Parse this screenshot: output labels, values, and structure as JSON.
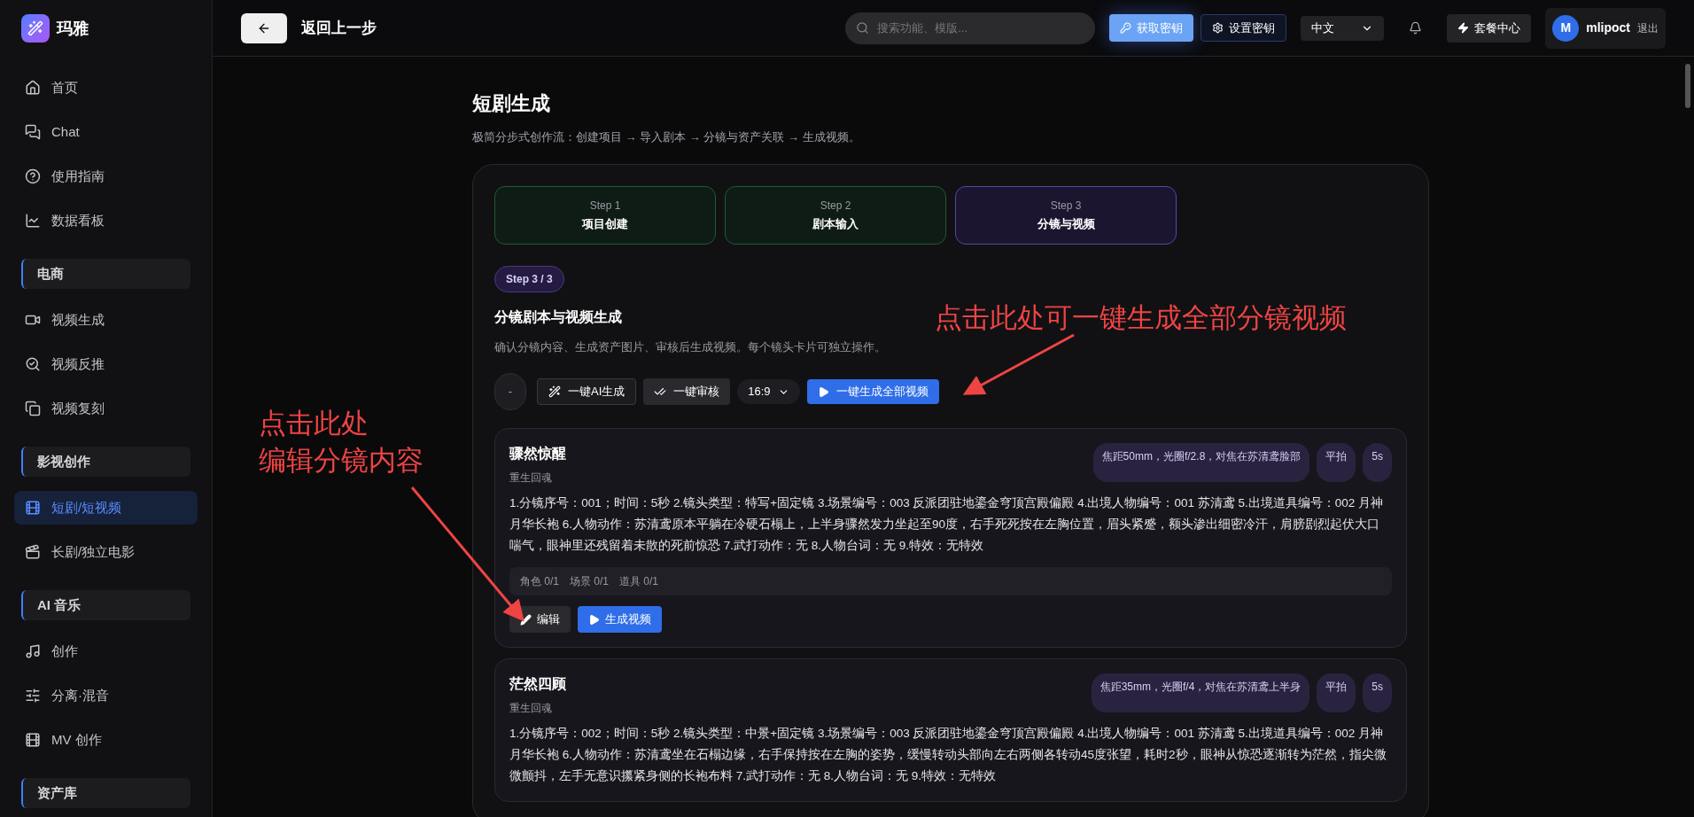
{
  "brand": {
    "name": "玛雅"
  },
  "sidebar": {
    "items": [
      {
        "kind": "item",
        "label": "首页",
        "selected": false
      },
      {
        "kind": "item",
        "label": "Chat",
        "selected": false
      },
      {
        "kind": "item",
        "label": "使用指南",
        "selected": false
      },
      {
        "kind": "item",
        "label": "数据看板",
        "selected": false
      },
      {
        "kind": "group",
        "label": "电商"
      },
      {
        "kind": "item",
        "label": "视频生成",
        "selected": false
      },
      {
        "kind": "item",
        "label": "视频反推",
        "selected": false
      },
      {
        "kind": "item",
        "label": "视频复刻",
        "selected": false
      },
      {
        "kind": "group",
        "label": "影视创作"
      },
      {
        "kind": "item",
        "label": "短剧/短视频",
        "selected": true
      },
      {
        "kind": "item",
        "label": "长剧/独立电影",
        "selected": false
      },
      {
        "kind": "group",
        "label": "AI 音乐"
      },
      {
        "kind": "item",
        "label": "创作",
        "selected": false
      },
      {
        "kind": "item",
        "label": "分离·混音",
        "selected": false
      },
      {
        "kind": "item",
        "label": "MV 创作",
        "selected": false
      },
      {
        "kind": "group",
        "label": "资产库"
      }
    ]
  },
  "topbar": {
    "back_label": "返回上一步",
    "search": {
      "placeholder": "搜索功能、模版..."
    },
    "get_key": "获取密钥",
    "set_key": "设置密钥",
    "language": "中文",
    "plans": "套餐中心",
    "user": {
      "initial": "M",
      "name": "mlipoct",
      "logout": "退出"
    }
  },
  "page": {
    "title": "短剧生成",
    "subtitle": "极简分步式创作流：创建项目 → 导入剧本 → 分镜与资产关联 → 生成视频。"
  },
  "steps": [
    {
      "step": "Step 1",
      "label": "项目创建",
      "selected": false
    },
    {
      "step": "Step 2",
      "label": "剧本输入",
      "selected": false
    },
    {
      "step": "Step 3",
      "label": "分镜与视频",
      "selected": true
    }
  ],
  "section": {
    "badge": "Step 3 / 3",
    "title": "分镜剧本与视频生成",
    "description": "确认分镜内容、生成资产图片、审核后生成视频。每个镜头卡片可独立操作。"
  },
  "toolbar": {
    "collapse": "-",
    "ai_generate": "一键AI生成",
    "review": "一键审核",
    "ratio": "16:9",
    "generate_all": "一键生成全部视频"
  },
  "shots": [
    {
      "title": "骤然惊醒",
      "subtitle": "重生回魂",
      "tags": [
        "焦距50mm，光圈f/2.8，对焦在苏清鸢脸部",
        "平拍",
        "5s"
      ],
      "description": "1.分镜序号：001；时间：5秒 2.镜头类型：特写+固定镜 3.场景编号：003 反派团驻地鎏金穹顶宫殿偏殿 4.出境人物编号：001 苏清鸢 5.出境道具编号：002 月神月华长袍 6.人物动作：苏清鸢原本平躺在冷硬石榻上，上半身骤然发力坐起至90度，右手死死按在左胸位置，眉头紧蹙，额头渗出细密冷汗，肩膀剧烈起伏大口喘气，眼神里还残留着未散的死前惊恐 7.武打动作：无 8.人物台词：无 9.特效：无特效",
      "assets": [
        "角色 0/1",
        "场景 0/1",
        "道具 0/1"
      ],
      "edit": "编辑",
      "generate": "生成视频"
    },
    {
      "title": "茫然四顾",
      "subtitle": "重生回魂",
      "tags": [
        "焦距35mm，光圈f/4，对焦在苏清鸢上半身",
        "平拍",
        "5s"
      ],
      "description": "1.分镜序号：002；时间：5秒 2.镜头类型：中景+固定镜 3.场景编号：003 反派团驻地鎏金穹顶宫殿偏殿 4.出境人物编号：001 苏清鸢 5.出境道具编号：002 月神月华长袍 6.人物动作：苏清鸢坐在石榻边缘，右手保持按在左胸的姿势，缓慢转动头部向左右两侧各转动45度张望，耗时2秒，眼神从惊恐逐渐转为茫然，指尖微微颤抖，左手无意识攥紧身侧的长袍布料 7.武打动作：无 8.人物台词：无 9.特效：无特效"
    }
  ],
  "annotations": [
    {
      "text": "点击此处可一键生成全部分镜视频"
    },
    {
      "text": "点击此处"
    },
    {
      "text": "编辑分镜内容"
    }
  ]
}
